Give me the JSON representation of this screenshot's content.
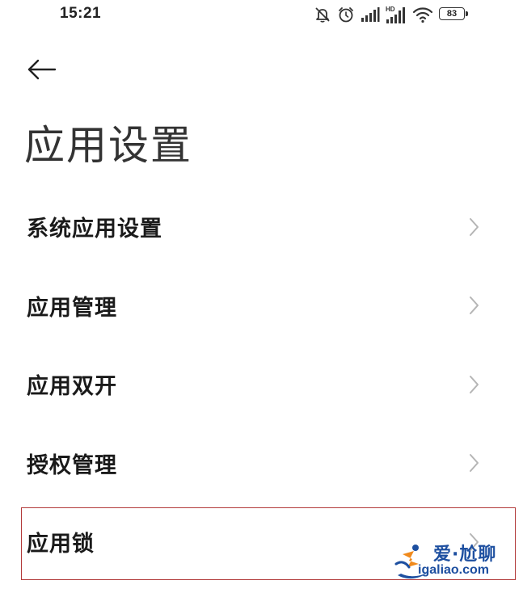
{
  "status_bar": {
    "time": "15:21",
    "battery": "83",
    "icons": [
      "mute-icon",
      "alarm-icon",
      "signal-icon",
      "hd-signal-icon",
      "wifi-icon",
      "battery-icon"
    ],
    "hd_label": "HD"
  },
  "header": {
    "back_icon": "back-arrow-icon",
    "title": "应用设置"
  },
  "menu": {
    "items": [
      {
        "label": "系统应用设置",
        "icon": "chevron-right-icon"
      },
      {
        "label": "应用管理",
        "icon": "chevron-right-icon"
      },
      {
        "label": "应用双开",
        "icon": "chevron-right-icon"
      },
      {
        "label": "授权管理",
        "icon": "chevron-right-icon"
      },
      {
        "label": "应用锁",
        "icon": "chevron-right-icon"
      }
    ]
  },
  "highlight_color": "#b23a3a",
  "watermark": {
    "top": "爱·尬聊",
    "bottom": "igaliao.com",
    "color": "#1d4fa0",
    "accent_color": "#f08a1c"
  }
}
